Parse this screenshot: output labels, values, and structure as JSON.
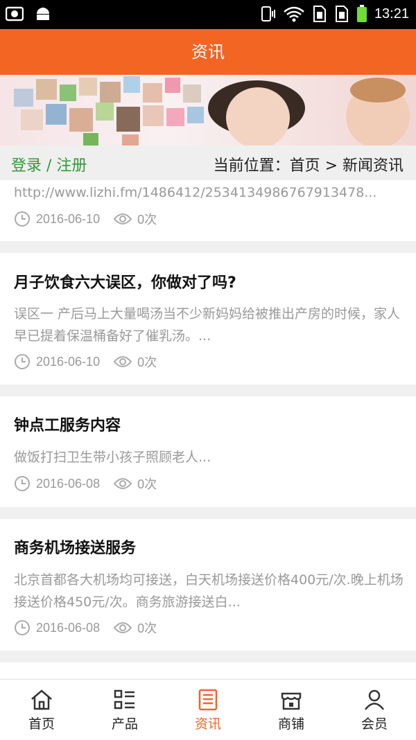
{
  "status_bar": {
    "time": "13:21",
    "icons": [
      "screenshot-icon",
      "android-icon",
      "phone-vibrate-icon",
      "wifi-icon",
      "sim1-icon",
      "sim2-icon",
      "battery-icon"
    ]
  },
  "header": {
    "title": "资讯"
  },
  "breadcrumb": {
    "login": "登录 / 注册",
    "location": "当前位置：首页 > 新闻资讯"
  },
  "articles": [
    {
      "title": "",
      "desc": "http://www.lizhi.fm/1486412/2534134986767913478...",
      "date": "2016-06-10",
      "views": "0次"
    },
    {
      "title": "月子饮食六大误区，你做对了吗?",
      "desc": "误区一  产后马上大量喝汤当不少新妈妈给被推出产房的时候，家人早已提着保温桶备好了催乳汤。...",
      "date": "2016-06-10",
      "views": "0次"
    },
    {
      "title": "钟点工服务内容",
      "desc": "做饭打扫卫生带小孩子照顾老人...",
      "date": "2016-06-08",
      "views": "0次"
    },
    {
      "title": "商务机场接送服务",
      "desc": "北京首都各大机场均可接送，白天机场接送价格400元/次.晚上机场接送价格450元/次。商务旅游接送白...",
      "date": "2016-06-08",
      "views": "0次"
    }
  ],
  "partial_title": "",
  "tabs": [
    {
      "label": "首页",
      "icon": "home-icon",
      "active": false
    },
    {
      "label": "产品",
      "icon": "list-icon",
      "active": false
    },
    {
      "label": "资讯",
      "icon": "news-icon",
      "active": true
    },
    {
      "label": "商铺",
      "icon": "shop-icon",
      "active": false
    },
    {
      "label": "会员",
      "icon": "user-icon",
      "active": false
    }
  ],
  "colors": {
    "accent": "#f26522",
    "link_green": "#2f9a36"
  }
}
